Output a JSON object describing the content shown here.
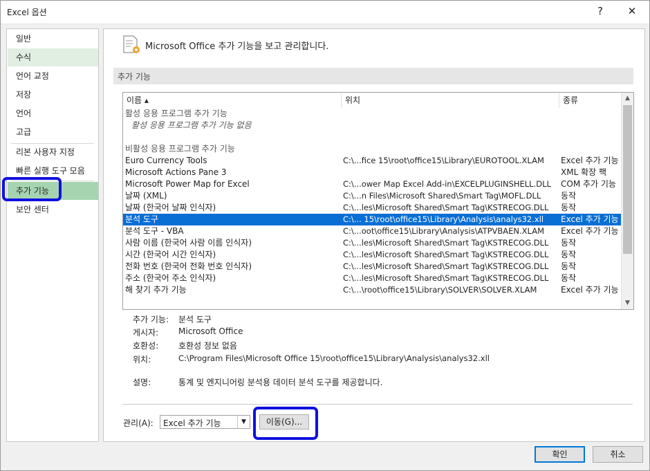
{
  "window": {
    "title": "Excel 옵션",
    "help_label": "?",
    "close_label": "✕"
  },
  "sidebar": {
    "items": [
      {
        "label": "일반"
      },
      {
        "label": "수식"
      },
      {
        "label": "언어 교정"
      },
      {
        "label": "저장"
      },
      {
        "label": "언어"
      },
      {
        "label": "고급"
      },
      {
        "label": "리본 사용자 지정"
      },
      {
        "label": "빠른 실행 도구 모음"
      },
      {
        "label": "추가 기능"
      },
      {
        "label": "보안 센터"
      }
    ],
    "selected_index": 8,
    "hover_index": 1
  },
  "main": {
    "header_icon": "addins-gear-icon",
    "header_text": "Microsoft Office 추가 기능을 보고 관리합니다.",
    "section_title": "추가 기능"
  },
  "addins_list": {
    "columns": [
      "이름 ▴",
      "위치",
      "종류"
    ],
    "rows": [
      {
        "name": "활성 응용 프로그램 추가 기능",
        "location": "",
        "type": "",
        "kind": "group"
      },
      {
        "name": "활성 응용 프로그램 추가 기능 없음",
        "location": "",
        "type": "",
        "kind": "empty"
      },
      {
        "name": "",
        "location": "",
        "type": "",
        "kind": "spacer"
      },
      {
        "name": "비활성 응용 프로그램 추가 기능",
        "location": "",
        "type": "",
        "kind": "group"
      },
      {
        "name": "Euro Currency Tools",
        "location": "C:\\...fice 15\\root\\office15\\Library\\EUROTOOL.XLAM",
        "type": "Excel 추가 기능",
        "kind": "item"
      },
      {
        "name": "Microsoft Actions Pane 3",
        "location": "",
        "type": "XML 확장 팩",
        "kind": "item"
      },
      {
        "name": "Microsoft Power Map for Excel",
        "location": "C:\\...ower Map Excel Add-in\\EXCELPLUGINSHELL.DLL",
        "type": "COM 추가 기능",
        "kind": "item"
      },
      {
        "name": "날짜 (XML)",
        "location": "C:\\...n Files\\Microsoft Shared\\Smart Tag\\MOFL.DLL",
        "type": "동작",
        "kind": "item"
      },
      {
        "name": "날짜 (한국어 날짜 인식자)",
        "location": "C:\\...les\\Microsoft Shared\\Smart Tag\\KSTRECOG.DLL",
        "type": "동작",
        "kind": "item"
      },
      {
        "name": "분석 도구",
        "location": "C:\\... 15\\root\\office15\\Library\\Analysis\\analys32.xll",
        "type": "Excel 추가 기능",
        "kind": "selected"
      },
      {
        "name": "분석 도구 - VBA",
        "location": "C:\\...oot\\office15\\Library\\Analysis\\ATPVBAEN.XLAM",
        "type": "Excel 추가 기능",
        "kind": "item"
      },
      {
        "name": "사람 이름 (한국어 사람 이름 인식자)",
        "location": "C:\\...les\\Microsoft Shared\\Smart Tag\\KSTRECOG.DLL",
        "type": "동작",
        "kind": "item"
      },
      {
        "name": "시간 (한국어 시간 인식자)",
        "location": "C:\\...les\\Microsoft Shared\\Smart Tag\\KSTRECOG.DLL",
        "type": "동작",
        "kind": "item"
      },
      {
        "name": "전화 번호 (한국어 전화 번호 인식자)",
        "location": "C:\\...les\\Microsoft Shared\\Smart Tag\\KSTRECOG.DLL",
        "type": "동작",
        "kind": "item"
      },
      {
        "name": "주소 (한국어 주소 인식자)",
        "location": "C:\\...les\\Microsoft Shared\\Smart Tag\\KSTRECOG.DLL",
        "type": "동작",
        "kind": "item"
      },
      {
        "name": "해 찾기 추가 기능",
        "location": "C:\\...\\root\\office15\\Library\\SOLVER\\SOLVER.XLAM",
        "type": "Excel 추가 기능",
        "kind": "item"
      }
    ]
  },
  "details": {
    "addin_label": "추가 기능:",
    "addin_value": "분석 도구",
    "publisher_label": "게시자:",
    "publisher_value": "Microsoft Office",
    "compat_label": "호환성:",
    "compat_value": "호환성 정보 없음",
    "location_label": "위치:",
    "location_value": "C:\\Program Files\\Microsoft Office 15\\root\\office15\\Library\\Analysis\\analys32.xll",
    "desc_label": "설명:",
    "desc_value": "통계 및 엔지니어링 분석용 데이터 분석 도구를 제공합니다."
  },
  "manage": {
    "label": "관리(A):",
    "selected": "Excel 추가 기능",
    "go_label": "이동(G)..."
  },
  "footer": {
    "ok_label": "확인",
    "cancel_label": "취소"
  },
  "colors": {
    "selected_nav": "#a6d4b1",
    "selected_row": "#0a6fd4",
    "annotation": "#1010e0"
  }
}
